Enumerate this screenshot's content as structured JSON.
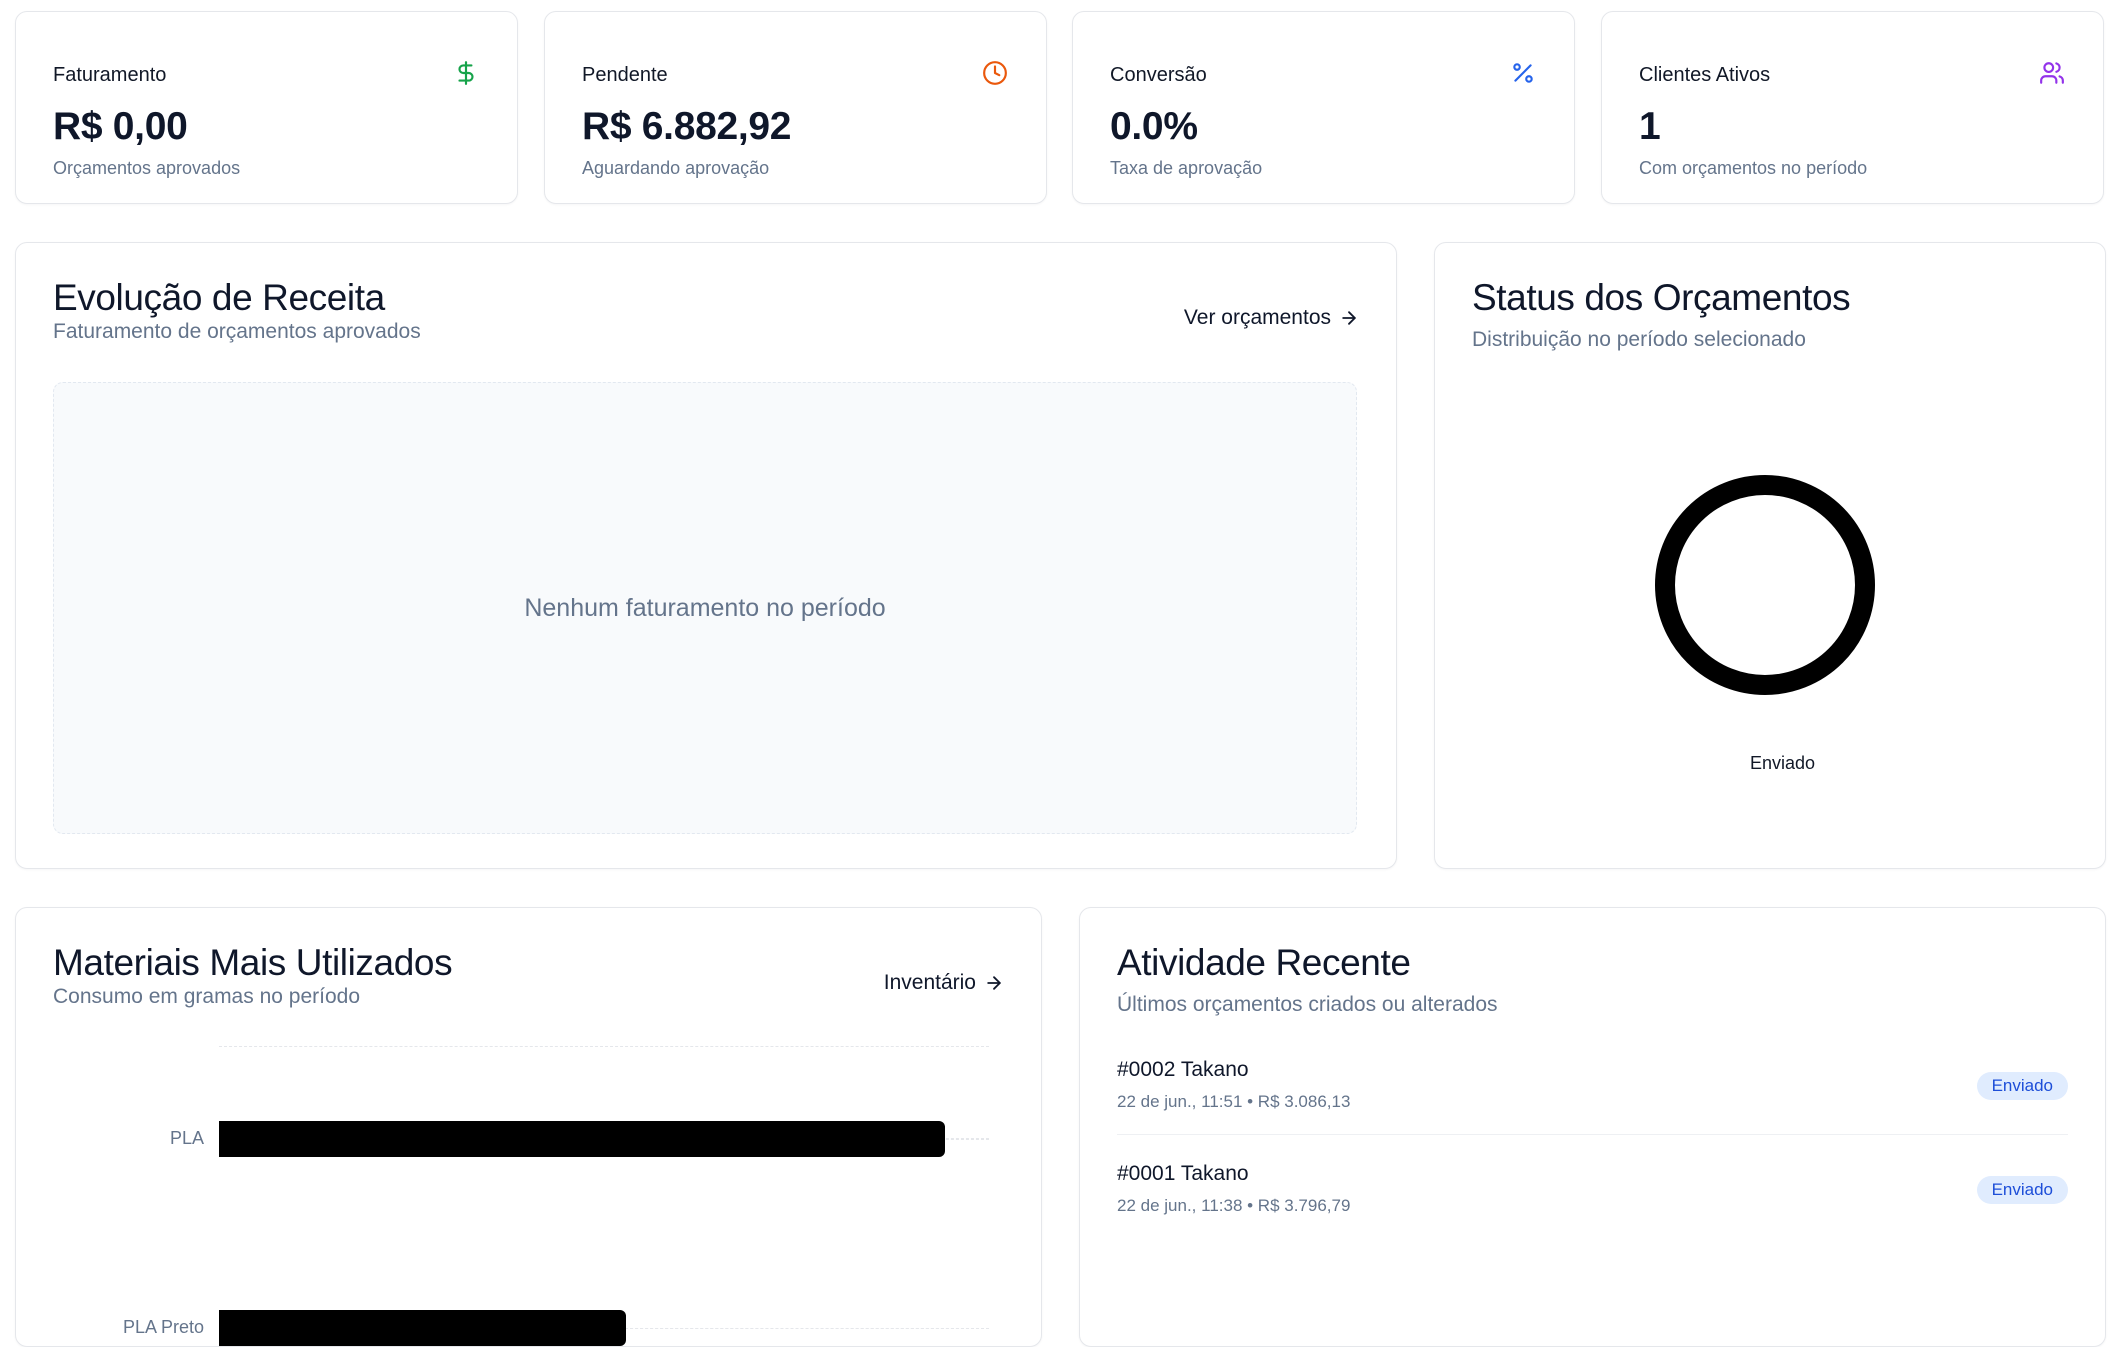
{
  "kpis": [
    {
      "label": "Faturamento",
      "value": "R$ 0,00",
      "sub": "Orçamentos aprovados",
      "icon": "dollar-icon",
      "color": "#16a34a"
    },
    {
      "label": "Pendente",
      "value": "R$ 6.882,92",
      "sub": "Aguardando aprovação",
      "icon": "clock-icon",
      "color": "#ea580c"
    },
    {
      "label": "Conversão",
      "value": "0.0%",
      "sub": "Taxa de aprovação",
      "icon": "percent-icon",
      "color": "#2563eb"
    },
    {
      "label": "Clientes Ativos",
      "value": "1",
      "sub": "Com orçamentos no período",
      "icon": "users-icon",
      "color": "#9333ea"
    }
  ],
  "revenue": {
    "title": "Evolução de Receita",
    "subtitle": "Faturamento de orçamentos aprovados",
    "link_label": "Ver orçamentos",
    "empty_text": "Nenhum faturamento no período"
  },
  "status": {
    "title": "Status dos Orçamentos",
    "subtitle": "Distribuição no período selecionado",
    "chart_data": {
      "type": "pie",
      "donut": true,
      "labels": [
        "Enviado"
      ],
      "values": [
        2
      ],
      "colors": [
        "#000000"
      ]
    }
  },
  "materials": {
    "title": "Materiais Mais Utilizados",
    "subtitle": "Consumo em gramas no período",
    "link_label": "Inventário",
    "chart_data": {
      "type": "bar",
      "orientation": "horizontal",
      "categories": [
        "PLA",
        "PLA Preto"
      ],
      "values": [
        100,
        56
      ],
      "grid": true
    }
  },
  "activity": {
    "title": "Atividade Recente",
    "subtitle": "Últimos orçamentos criados ou alterados",
    "items": [
      {
        "title": "#0002 Takano",
        "meta": "22 de jun., 11:51 • R$ 3.086,13",
        "badge": "Enviado"
      },
      {
        "title": "#0001 Takano",
        "meta": "22 de jun., 11:38 • R$ 3.796,79",
        "badge": "Enviado"
      }
    ]
  }
}
